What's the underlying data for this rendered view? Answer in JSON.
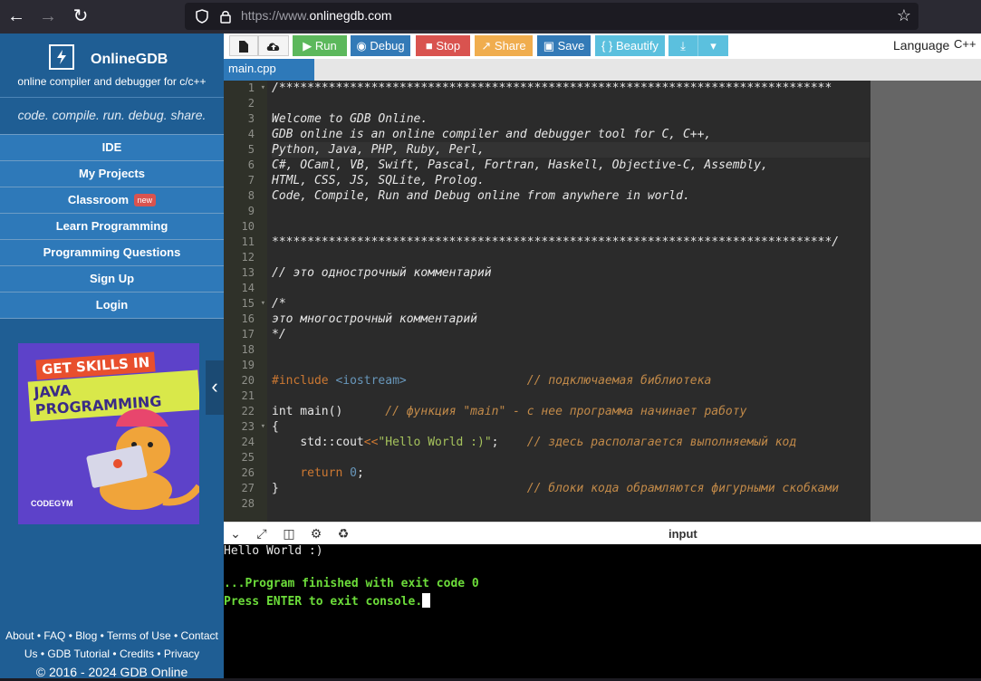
{
  "browser": {
    "url_prefix": "https://www.",
    "url_domain": "onlinegdb.com",
    "back_icon": "arrow-left-icon",
    "forward_icon": "arrow-right-icon",
    "reload_icon": "reload-icon"
  },
  "sidebar": {
    "brand_name": "OnlineGDB",
    "brand_tagline": "online compiler and debugger for c/c++",
    "motto": "code. compile. run. debug. share.",
    "menu": [
      {
        "label": "IDE"
      },
      {
        "label": "My Projects"
      },
      {
        "label": "Classroom",
        "badge": "new"
      },
      {
        "label": "Learn Programming"
      },
      {
        "label": "Programming Questions"
      },
      {
        "label": "Sign Up"
      },
      {
        "label": "Login"
      }
    ],
    "ad": {
      "line1": "GET SKILLS IN",
      "line2": "JAVA PROGRAMMING",
      "brand": "CODEGYM"
    },
    "footer": {
      "about": "About",
      "faq": "FAQ",
      "blog": "Blog",
      "terms": "Terms of Use",
      "contact": "Contact Us",
      "tutorial": "GDB Tutorial",
      "credits": "Credits",
      "privacy": "Privacy",
      "copyright": "© 2016 - 2024 GDB Online"
    }
  },
  "toolbar": {
    "run": "Run",
    "debug": "Debug",
    "stop": "Stop",
    "share": "Share",
    "save": "Save",
    "beautify": "{ } Beautify",
    "language_label": "Language",
    "language_value": "C++",
    "colors": {
      "run": "#5cb85c",
      "debug": "#337ab7",
      "stop": "#d9534f",
      "share": "#f0ad4e",
      "save": "#337ab7",
      "beautify": "#5bc0de",
      "download": "#5bc0de"
    }
  },
  "tabs": [
    {
      "label": "main.cpp"
    }
  ],
  "editor": {
    "line_numbers": [
      "1",
      "2",
      "3",
      "4",
      "5",
      "6",
      "7",
      "8",
      "9",
      "10",
      "11",
      "12",
      "13",
      "14",
      "15",
      "16",
      "17",
      "18",
      "19",
      "20",
      "21",
      "22",
      "23",
      "24",
      "25",
      "26",
      "27",
      "28"
    ],
    "lines": {
      "l1": "/******************************************************************************",
      "l3": "Welcome to GDB Online.",
      "l4": "GDB online is an online compiler and debugger tool for C, C++,",
      "l5": "Python, Java, PHP, Ruby, Perl,",
      "l6": "C#, OCaml, VB, Swift, Pascal, Fortran, Haskell, Objective-C, Assembly,",
      "l7": "HTML, CSS, JS, SQLite, Prolog.",
      "l8": "Code, Compile, Run and Debug online from anywhere in world.",
      "l11": "*******************************************************************************/",
      "l13": "// это однострочный комментарий",
      "l15": "/*",
      "l16": "это многострочный комментарий",
      "l17": "*/",
      "l20_kw": "#include",
      "l20_inc": "<iostream>",
      "l20_com": "// подключаемая библиотека",
      "l22_code": "int main()",
      "l22_com": "// функция \"main\" - с нее программа начинает работу",
      "l23": "{",
      "l24_a": "std::cout",
      "l24_op": "<<",
      "l24_str": "\"Hello World :)\"",
      "l24_end": ";",
      "l24_com": "// здесь располагается выполняемый код",
      "l26_kw": "return",
      "l26_num": "0",
      "l26_end": ";",
      "l27": "}",
      "l27_com": "// блоки кода обрамляются фигурными скобками"
    }
  },
  "console": {
    "input_label": "input",
    "output_line": "Hello World :)",
    "finished": "...Program finished with exit code 0",
    "press_enter": "Press ENTER to exit console."
  }
}
